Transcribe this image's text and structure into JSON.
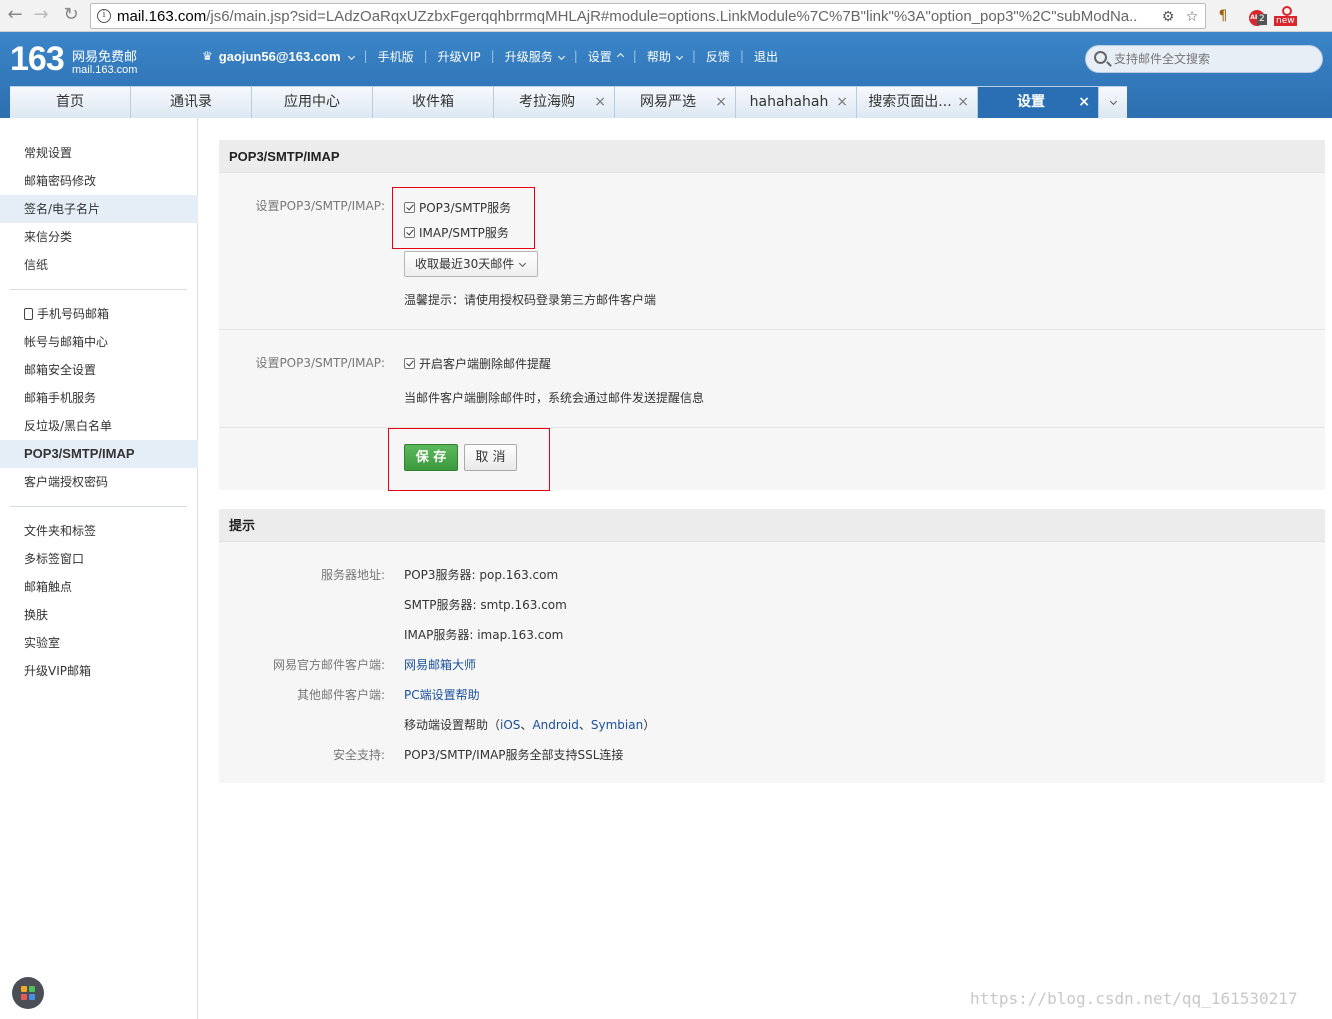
{
  "browser": {
    "url_host": "mail.163.com",
    "url_path": "/js6/main.jsp?sid=LAdzOaRqxUZzbxFgerqqhbrrmqMHLAjR#module=options.LinkModule%7C%7B\"link\"%3A\"option_pop3\"%2C\"subModNa...",
    "ext_abp_count": "2",
    "ext_new_label": "new"
  },
  "header": {
    "logo_number": "163",
    "logo_title": "网易免费邮",
    "logo_domain": "mail.163.com",
    "user": "gaojun56@163.com",
    "nav": [
      "手机版",
      "升级VIP",
      "升级服务",
      "设置",
      "帮助",
      "反馈",
      "退出"
    ],
    "search_placeholder": "支持邮件全文搜索"
  },
  "tabs": [
    {
      "label": "首页"
    },
    {
      "label": "通讯录"
    },
    {
      "label": "应用中心"
    },
    {
      "label": "收件箱"
    },
    {
      "label": "考拉海购"
    },
    {
      "label": "网易严选"
    },
    {
      "label": "hahahahah"
    },
    {
      "label": "搜索页面出..."
    },
    {
      "label": "设置"
    }
  ],
  "sidebar": {
    "group1": [
      "常规设置",
      "邮箱密码修改",
      "签名/电子名片",
      "来信分类",
      "信纸"
    ],
    "group2": [
      "手机号码邮箱",
      "帐号与邮箱中心",
      "邮箱安全设置",
      "邮箱手机服务",
      "反垃圾/黑白名单",
      "POP3/SMTP/IMAP",
      "客户端授权密码"
    ],
    "group3": [
      "文件夹和标签",
      "多标签窗口",
      "邮箱触点",
      "换肤",
      "实验室",
      "升级VIP邮箱"
    ]
  },
  "pop3": {
    "title": "POP3/SMTP/IMAP",
    "label1": "设置POP3/SMTP/IMAP:",
    "opt_pop3": "POP3/SMTP服务",
    "opt_imap": "IMAP/SMTP服务",
    "fetch_select": "收取最近30天邮件",
    "tip": "温馨提示：请使用授权码登录第三方邮件客户端",
    "label2": "设置POP3/SMTP/IMAP:",
    "opt_delete_notify": "开启客户端删除邮件提醒",
    "delete_note": "当邮件客户端删除邮件时，系统会通过邮件发送提醒信息",
    "save": "保 存",
    "cancel": "取 消"
  },
  "hints": {
    "title": "提示",
    "server_label": "服务器地址:",
    "pop3_server": "POP3服务器: pop.163.com",
    "smtp_server": "SMTP服务器: smtp.163.com",
    "imap_server": "IMAP服务器: imap.163.com",
    "official_label": "网易官方邮件客户端:",
    "official_link": "网易邮箱大师",
    "other_label": "其他邮件客户端:",
    "pc_link": "PC端设置帮助",
    "mobile_prefix": "移动端设置帮助（",
    "ios": "iOS",
    "android": "Android",
    "symbian": "Symbian",
    "sep": "、",
    "mobile_suffix": "）",
    "security_label": "安全支持:",
    "security_value": "POP3/SMTP/IMAP服务全部支持SSL连接"
  },
  "watermark": "https://blog.csdn.net/qq_161530217"
}
